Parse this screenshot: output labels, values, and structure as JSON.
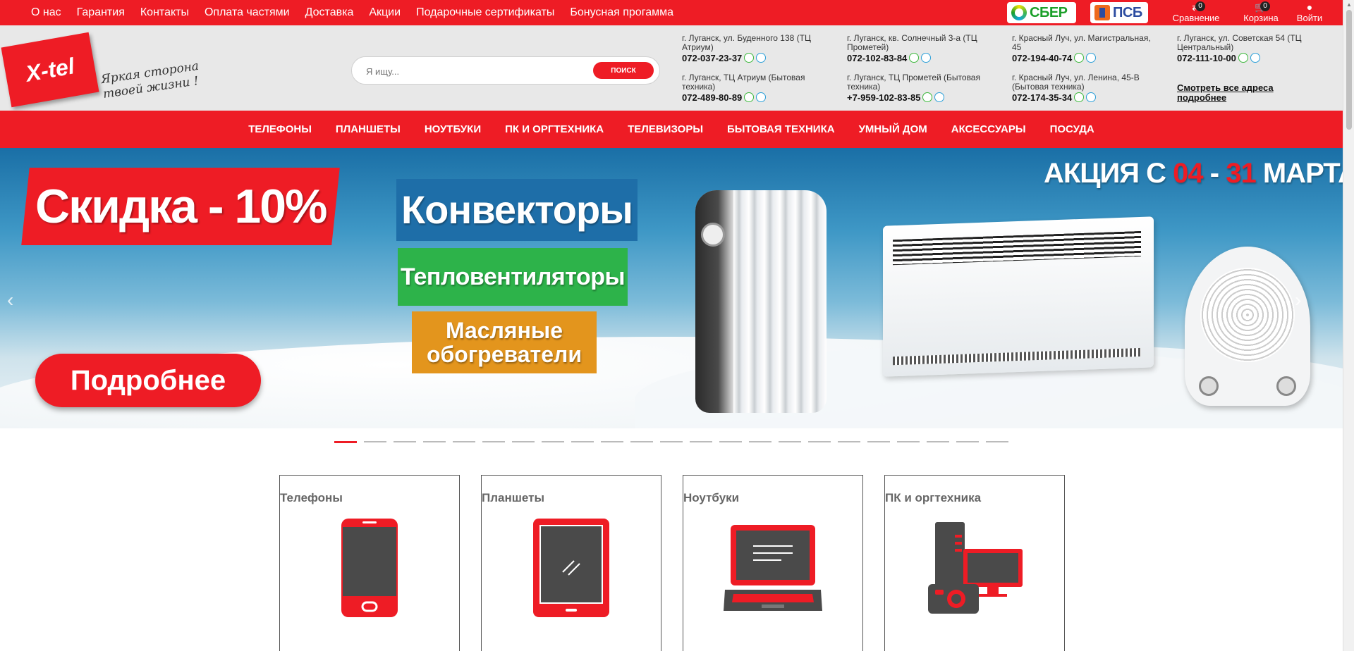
{
  "top_nav": [
    "О нас",
    "Гарантия",
    "Контакты",
    "Оплата частями",
    "Доставка",
    "Акции",
    "Подарочные сертификаты",
    "Бонусная прогамма"
  ],
  "banks": {
    "sber": "СБЕР",
    "psb": "ПСБ"
  },
  "tools": {
    "compare": {
      "label": "Сравнение",
      "count": "0"
    },
    "cart": {
      "label": "Корзина",
      "count": "0"
    },
    "login": {
      "label": "Войти"
    }
  },
  "logo": {
    "text": "X-tel",
    "slogan": "Яркая сторона твоей жизни !"
  },
  "search": {
    "placeholder": "Я ищу...",
    "button": "ПОИСК"
  },
  "stores": [
    {
      "address": "г. Луганск, ул. Буденного 138 (ТЦ Атриум)",
      "phone": "072-037-23-37"
    },
    {
      "address": "г. Луганск, кв. Солнечный 3-а (ТЦ Прометей)",
      "phone": "072-102-83-84"
    },
    {
      "address": "г. Красный Луч, ул. Магистральная, 45",
      "phone": "072-194-40-74"
    },
    {
      "address": "г. Луганск, ул. Советская 54 (ТЦ Центральный)",
      "phone": "072-111-10-00"
    },
    {
      "address": "г. Луганск, ТЦ Атриум (Бытовая техника)",
      "phone": "072-489-80-89"
    },
    {
      "address": "г. Луганск, ТЦ Прометей (Бытовая техника)",
      "phone": "+7-959-102-83-85"
    },
    {
      "address": "г. Красный Луч, ул. Ленина, 45-В (Бытовая техника)",
      "phone": "072-174-35-34"
    }
  ],
  "all_addresses_link": "Смотреть все адреса подробнее",
  "catalog_nav": [
    "ТЕЛЕФОНЫ",
    "ПЛАНШЕТЫ",
    "НОУТБУКИ",
    "ПК И ОРГТЕХНИКА",
    "ТЕЛЕВИЗОРЫ",
    "БЫТОВАЯ ТЕХНИКА",
    "УМНЫЙ ДОМ",
    "АКСЕССУАРЫ",
    "ПОСУДА"
  ],
  "banner": {
    "discount": "Скидка - 10%",
    "tag1": "Конвекторы",
    "tag2": "Тепловентиляторы",
    "tag3": "Масляные обогреватели",
    "more": "Подробнее",
    "action_prefix": "АКЦИЯ С",
    "action_from": "04",
    "action_dash": "-",
    "action_to": "31",
    "action_month": "МАРТА"
  },
  "carousel": {
    "slides": 23,
    "active": 1
  },
  "categories": [
    "Телефоны",
    "Планшеты",
    "Ноутбуки",
    "ПК и оргтехника"
  ],
  "colors": {
    "brand_red": "#ee1c25",
    "header_grey": "#e8e8e8",
    "icon_dark": "#4a4a4a"
  }
}
